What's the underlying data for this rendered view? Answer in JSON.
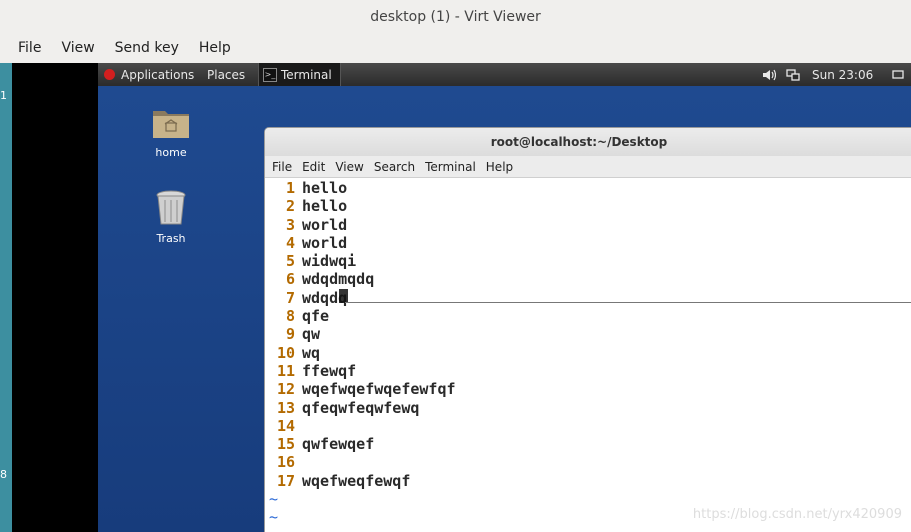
{
  "window": {
    "title": "desktop (1) - Virt Viewer",
    "menu": [
      "File",
      "View",
      "Send key",
      "Help"
    ]
  },
  "host": {
    "left_marker_top": "1",
    "left_marker_bottom": "8"
  },
  "gnome_bar": {
    "applications": "Applications",
    "places": "Places",
    "terminal_task": "Terminal",
    "clock": "Sun 23:06"
  },
  "desktop_icons": [
    {
      "label": "home",
      "icon": "folder-icon"
    },
    {
      "label": "Trash",
      "icon": "trash-icon"
    }
  ],
  "terminal": {
    "title": "root@localhost:~/Desktop",
    "menu": [
      "File",
      "Edit",
      "View",
      "Search",
      "Terminal",
      "Help"
    ],
    "lines": [
      {
        "n": "1",
        "text": "hello"
      },
      {
        "n": "2",
        "text": "hello"
      },
      {
        "n": "3",
        "text": "world"
      },
      {
        "n": "4",
        "text": "world"
      },
      {
        "n": "5",
        "text": "widwqi"
      },
      {
        "n": "6",
        "text": "wdqdmqdq"
      },
      {
        "n": "7",
        "text": "wdqdq"
      },
      {
        "n": "8",
        "text": "qfe"
      },
      {
        "n": "9",
        "text": "qw"
      },
      {
        "n": "10",
        "text": "wq"
      },
      {
        "n": "11",
        "text": "ffewqf"
      },
      {
        "n": "12",
        "text": "wqefwqefwqefewfqf"
      },
      {
        "n": "13",
        "text": "qfeqwfeqwfewq"
      },
      {
        "n": "14",
        "text": ""
      },
      {
        "n": "15",
        "text": "qwfewqef"
      },
      {
        "n": "16",
        "text": ""
      },
      {
        "n": "17",
        "text": "wqefweqfewqf"
      }
    ],
    "tilde": "~"
  },
  "watermark": "https://blog.csdn.net/yrx420909"
}
